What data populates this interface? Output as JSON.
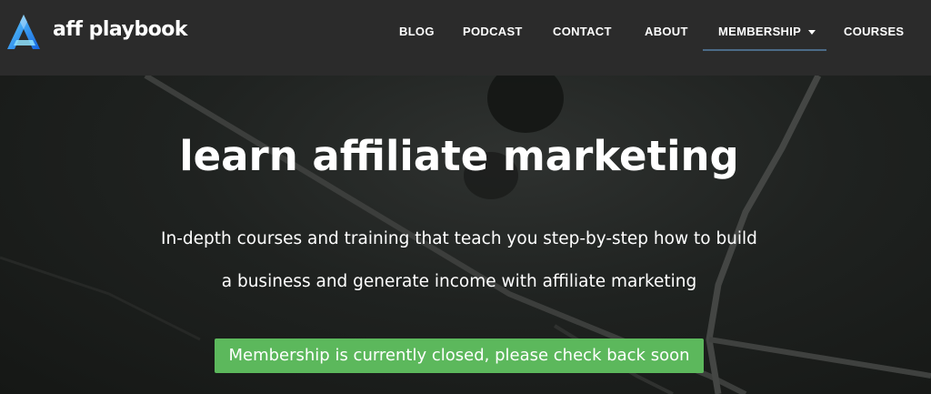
{
  "header": {
    "brand": "aff playbook",
    "nav": [
      {
        "label": "BLOG"
      },
      {
        "label": "PODCAST"
      },
      {
        "label": "CONTACT"
      },
      {
        "label": "ABOUT"
      },
      {
        "label": "MEMBERSHIP",
        "has_dropdown": true,
        "active": true
      },
      {
        "label": "COURSES"
      }
    ]
  },
  "hero": {
    "title": "learn affiliate marketing",
    "subtitle_line1": "In-depth courses and training that teach you step-by-step how to build",
    "subtitle_line2": "a business and generate income with affiliate marketing",
    "notice": "Membership is currently closed, please check back soon"
  },
  "colors": {
    "header_bg": "#2b2b2b",
    "logo_accent": "#1e90ff",
    "nav_active_underline": "#4b6a87",
    "notice_bg": "#5cb85c"
  },
  "icons": {
    "logo": "aff-playbook-logo-icon",
    "dropdown": "caret-down-icon"
  }
}
